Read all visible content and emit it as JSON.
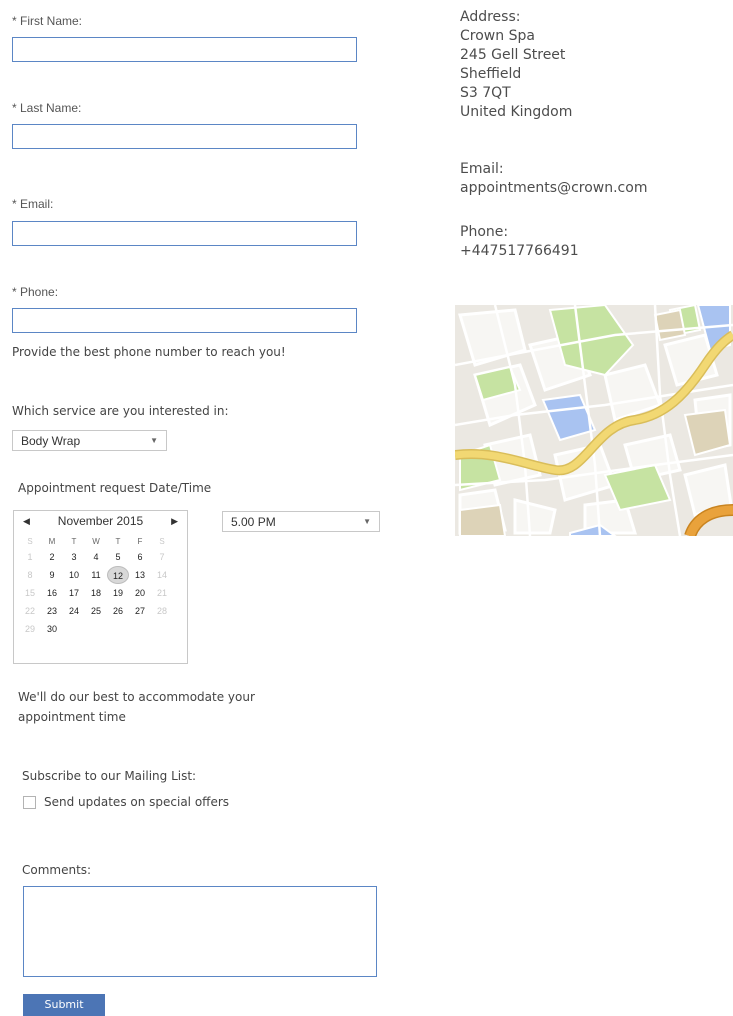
{
  "form": {
    "first_name_label": "* First Name:",
    "last_name_label": "* Last Name:",
    "email_label": "* Email:",
    "phone_label": "* Phone:",
    "phone_help": "Provide the best phone number to reach you!",
    "service_label": "Which service are you interested in:",
    "service_value": "Body Wrap",
    "datetime_label": "Appointment request Date/Time",
    "calendar": {
      "month_label": "November 2015",
      "weekdays": [
        "S",
        "M",
        "T",
        "W",
        "T",
        "F",
        "S"
      ],
      "weeks": [
        [
          "1",
          "2",
          "3",
          "4",
          "5",
          "6",
          "7"
        ],
        [
          "8",
          "9",
          "10",
          "11",
          "12",
          "13",
          "14"
        ],
        [
          "15",
          "16",
          "17",
          "18",
          "19",
          "20",
          "21"
        ],
        [
          "22",
          "23",
          "24",
          "25",
          "26",
          "27",
          "28"
        ],
        [
          "29",
          "30",
          "",
          "",
          "",
          "",
          ""
        ]
      ],
      "selected_day": "12"
    },
    "time_value": "5.00 PM",
    "accommodate_note_line1": "We'll do our best to accommodate your",
    "accommodate_note_line2": "appointment time",
    "mailing_label": "Subscribe to our Mailing List:",
    "mailing_checkbox_label": "Send updates on special offers",
    "comments_label": "Comments:",
    "submit_label": "Submit"
  },
  "contact": {
    "address_label": "Address:",
    "address_lines": [
      "Crown Spa",
      "245 Gell Street",
      "Sheffield",
      "S3 7QT",
      "United Kingdom"
    ],
    "email_label": "Email:",
    "email_value": "appointments@crown.com",
    "phone_label": "Phone:",
    "phone_value": "+447517766491"
  },
  "colors": {
    "field_border": "#5b86c5",
    "submit_bg": "#4c75b5",
    "map_road": "#f2d873",
    "map_highway": "#e9a23b",
    "map_park": "#c6e3a2",
    "map_water": "#a9c3f1"
  }
}
